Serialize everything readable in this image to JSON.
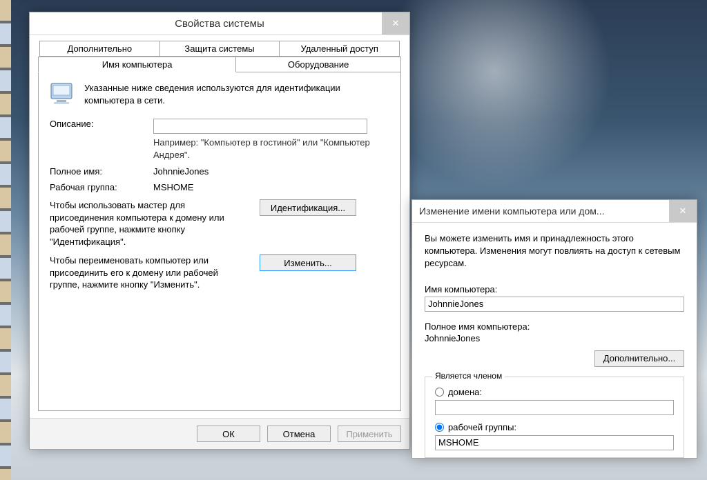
{
  "sysprops": {
    "title": "Свойства системы",
    "tabs_row1": [
      "Дополнительно",
      "Защита системы",
      "Удаленный доступ"
    ],
    "tabs_row2": [
      "Имя компьютера",
      "Оборудование"
    ],
    "intro": "Указанные ниже сведения используются для идентификации компьютера в сети.",
    "desc_label": "Описание:",
    "desc_value": "",
    "desc_hint": "Например: \"Компьютер в гостиной\" или \"Компьютер Андрея\".",
    "fullname_label": "Полное имя:",
    "fullname_value": "JohnnieJones",
    "workgroup_label": "Рабочая группа:",
    "workgroup_value": "MSHOME",
    "wizard_hint": "Чтобы использовать мастер для присоединения компьютера к домену или рабочей группе, нажмите кнопку \"Идентификация\".",
    "wizard_btn": "Идентификация...",
    "change_hint": "Чтобы переименовать компьютер или присоединить его к домену или рабочей группе, нажмите кнопку \"Изменить\".",
    "change_btn": "Изменить...",
    "ok": "ОК",
    "cancel": "Отмена",
    "apply": "Применить"
  },
  "rename": {
    "title": "Изменение имени компьютера или дом...",
    "intro": "Вы можете изменить имя и принадлежность этого компьютера. Изменения могут повлиять на доступ к сетевым ресурсам.",
    "name_label": "Имя компьютера:",
    "name_value": "JohnnieJones",
    "full_label": "Полное имя компьютера:",
    "full_value": "JohnnieJones",
    "more_btn": "Дополнительно...",
    "member_legend": "Является членом",
    "domain_label": "домена:",
    "domain_value": "",
    "workgroup_label": "рабочей группы:",
    "workgroup_value": "MSHOME",
    "member_choice": "workgroup"
  }
}
